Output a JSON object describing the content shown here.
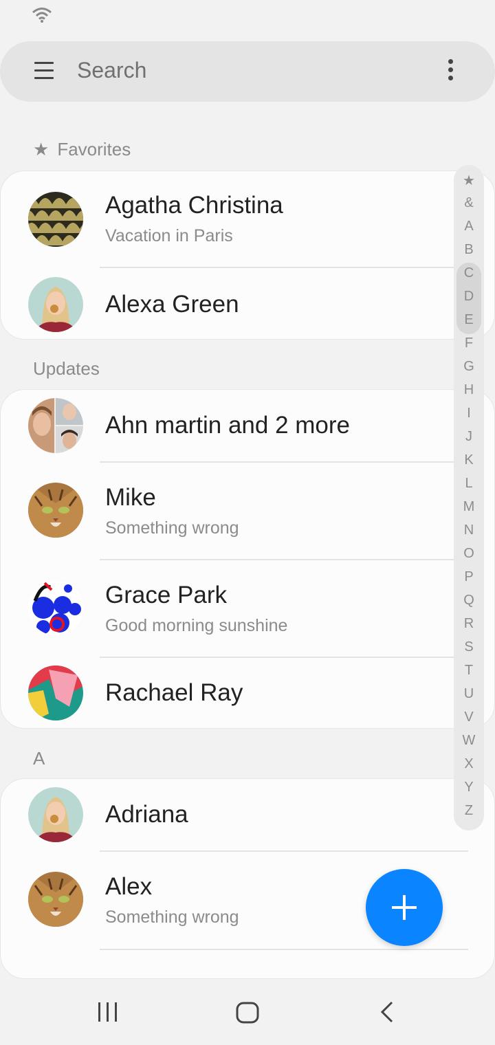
{
  "status_bar": {
    "wifi_icon": "wifi-icon"
  },
  "search": {
    "placeholder": "Search",
    "menu_icon": "hamburger-menu-icon",
    "more_icon": "more-vertical-icon"
  },
  "sections": {
    "favorites": {
      "title": "Favorites",
      "contacts": [
        {
          "name": "Agatha Christina",
          "status": "Vacation in Paris"
        },
        {
          "name": "Alexa Green",
          "status": ""
        }
      ]
    },
    "updates": {
      "title": "Updates",
      "contacts": [
        {
          "name": "Ahn martin and 2 more",
          "status": ""
        },
        {
          "name": "Mike",
          "status": "Something wrong"
        },
        {
          "name": "Grace Park",
          "status": "Good morning sunshine"
        },
        {
          "name": "Rachael Ray",
          "status": ""
        }
      ]
    },
    "a": {
      "title": "A",
      "contacts": [
        {
          "name": "Adriana",
          "status": ""
        },
        {
          "name": "Alex",
          "status": "Something wrong"
        }
      ]
    }
  },
  "index_letters": [
    "★",
    "&",
    "A",
    "B",
    "C",
    "D",
    "E",
    "F",
    "G",
    "H",
    "I",
    "J",
    "K",
    "L",
    "M",
    "N",
    "O",
    "P",
    "Q",
    "R",
    "S",
    "T",
    "U",
    "V",
    "W",
    "X",
    "Y",
    "Z"
  ],
  "fab": {
    "icon": "plus-icon"
  },
  "nav": {
    "recents_icon": "recents-icon",
    "home_icon": "home-icon",
    "back_icon": "back-icon"
  },
  "colors": {
    "accent": "#0a84ff",
    "background": "#f2f2f2",
    "card": "#fcfcfc"
  }
}
